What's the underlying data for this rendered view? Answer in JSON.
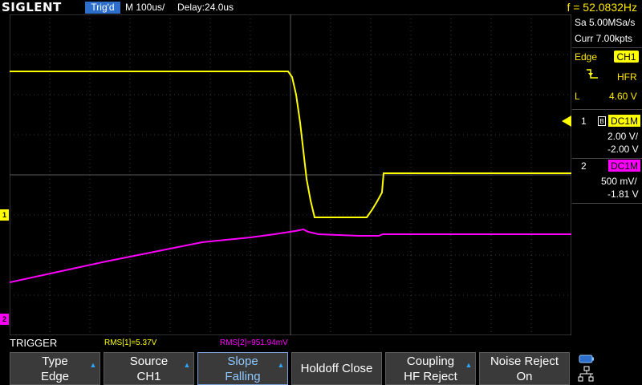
{
  "topbar": {
    "brand": "SIGLENT",
    "run_state": "Trig'd",
    "timebase": "M 100us/",
    "delay": "Delay:24.0us",
    "frequency": "f = 52.0832Hz"
  },
  "acquisition": {
    "sample_rate": "Sa 5.00MSa/s",
    "memory": "Curr 7.00kpts"
  },
  "trigger_info": {
    "type": "Edge",
    "source": "CH1",
    "coupling": "HFR",
    "level_label": "L",
    "level": "4.60 V"
  },
  "channels": [
    {
      "number": "1",
      "coupling": "DC1M",
      "scale": "2.00 V/",
      "offset": "-2.00 V",
      "color": "#ffff00"
    },
    {
      "number": "2",
      "coupling": "DC1M",
      "scale": "500 mV/",
      "offset": "-1.81 V",
      "color": "#ff00ff"
    }
  ],
  "channel_markers": {
    "ch1": "1",
    "ch2": "2"
  },
  "measurements": {
    "rms1": "RMS[1]=5.37V",
    "rms2": "RMS[2]=951.94mV"
  },
  "menu": {
    "title": "TRIGGER",
    "softkeys": [
      {
        "line1": "Type",
        "line2": "Edge"
      },
      {
        "line1": "Source",
        "line2": "CH1"
      },
      {
        "line1": "Slope",
        "line2": "Falling"
      },
      {
        "label": "Holdoff Close"
      },
      {
        "line1": "Coupling",
        "line2": "HF Reject"
      },
      {
        "line1": "Noise Reject",
        "line2": "On"
      }
    ]
  },
  "colors": {
    "ch1": "#ffff00",
    "ch2": "#ff00ff",
    "accent": "#2c6ec9",
    "grid": "#3a3a3a"
  }
}
